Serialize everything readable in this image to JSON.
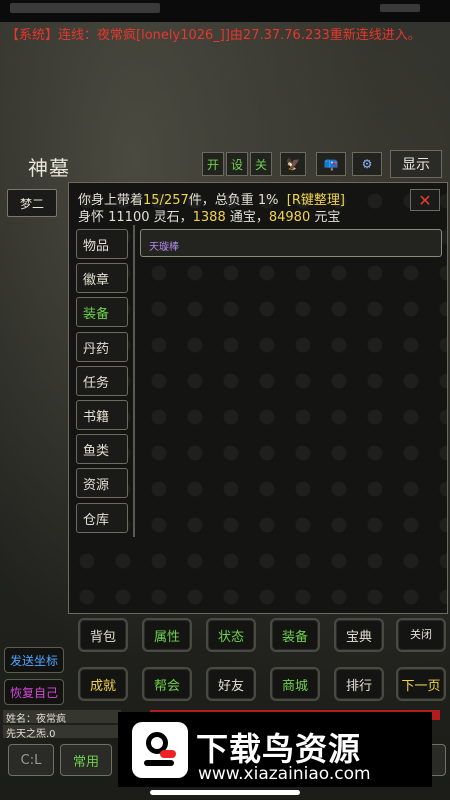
{
  "system_message": {
    "tag": "【系统】",
    "text": "连线：夜常疯[lonely1026_]]由27.37.76.233重新连线进入。"
  },
  "header": {
    "title": "神墓",
    "buttons": {
      "open": "开",
      "settings": "设",
      "close": "关",
      "show": "显示"
    }
  },
  "left_tab": "梦二",
  "inventory": {
    "line1_prefix": "你身上带着",
    "count": "15/257",
    "line1_mid": "件，总负重 1%",
    "sort_label": "[R键整理]",
    "line2_prefix": "身怀 11100 灵石，",
    "tongbao": "1388",
    "line2_mid": " 通宝，",
    "yuanbao": "84980",
    "line2_suffix": " 元宝",
    "close_label": "✕"
  },
  "categories": [
    "物品",
    "徽章",
    "装备",
    "丹药",
    "任务",
    "书籍",
    "鱼类",
    "资源",
    "仓库"
  ],
  "active_category": "装备",
  "items": [
    "天璇棒"
  ],
  "grid": {
    "row1": [
      "背包",
      "属性",
      "状态",
      "装备",
      "宝典",
      "关闭"
    ],
    "row2": [
      "成就",
      "帮会",
      "好友",
      "商城",
      "排行",
      "下一页"
    ]
  },
  "side_controls": {
    "send_coord": "发送坐标",
    "recover": "恢复自己"
  },
  "player": {
    "name_label": "姓名：夜常疯",
    "exp_label": "先天之炁.0"
  },
  "bottom": {
    "c_label": "C:L",
    "common": "常用"
  },
  "watermark": {
    "brand": "下载鸟资源",
    "url": "www.xiazainiao.com"
  },
  "colors": {
    "accent_green": "#6fd14b",
    "accent_yellow": "#f0d34b",
    "alert_red": "#e8362b",
    "item_purple": "#b38be8"
  }
}
